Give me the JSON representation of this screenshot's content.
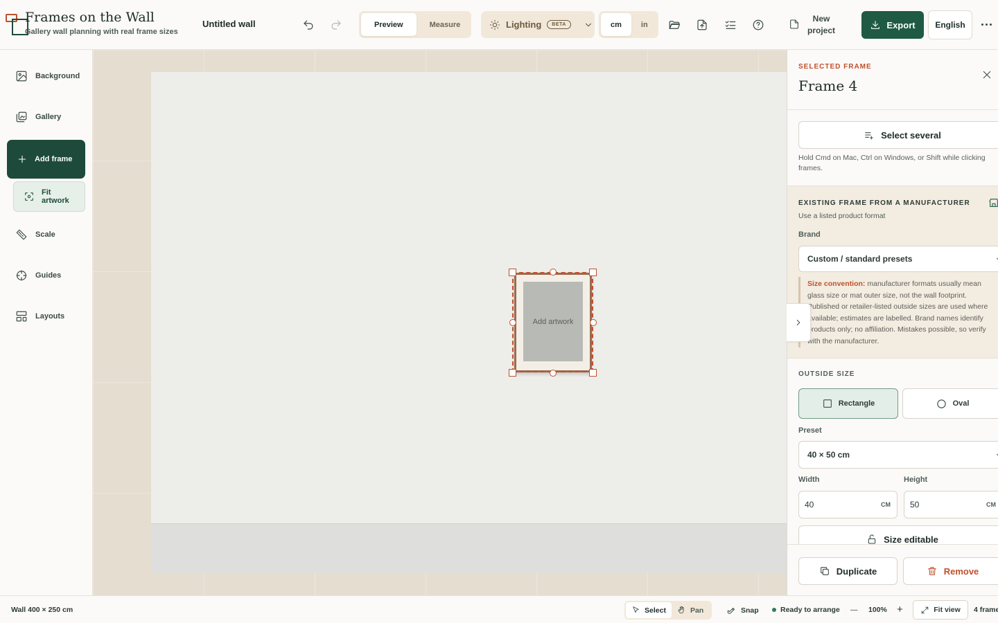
{
  "app": {
    "title": "Frames on the Wall",
    "subtitle": "Gallery wall planning with real frame sizes",
    "document_title": "Untitled wall"
  },
  "toolbar": {
    "undo_icon": "undo-icon",
    "redo_icon": "redo-icon",
    "view_modes": [
      {
        "label": "Preview",
        "active": true
      },
      {
        "label": "Measure",
        "active": false
      }
    ],
    "lighting_label": "Lighting",
    "lighting_badge": "BETA",
    "units": [
      {
        "label": "cm",
        "active": true
      },
      {
        "label": "in",
        "active": false
      }
    ],
    "new_project_label": "New project",
    "export_label": "Export",
    "language_label": "English"
  },
  "sidebar": {
    "items": [
      {
        "label": "Background",
        "icon": "image-icon"
      },
      {
        "label": "Gallery",
        "icon": "gallery-icon"
      },
      {
        "label": "Add frame",
        "icon": "plus-icon"
      },
      {
        "label": "Fit artwork",
        "icon": "fit-icon"
      },
      {
        "label": "Scale",
        "icon": "ruler-icon"
      },
      {
        "label": "Guides",
        "icon": "crosshair-icon"
      },
      {
        "label": "Layouts",
        "icon": "layout-icon"
      }
    ]
  },
  "canvas": {
    "frame_placeholder": "Add artwork"
  },
  "panel": {
    "eyebrow": "SELECTED FRAME",
    "title": "Frame 4",
    "select_several_label": "Select several",
    "select_hint": "Hold Cmd on Mac, Ctrl on Windows, or Shift while clicking frames.",
    "manufacturer": {
      "heading": "EXISTING FRAME FROM A MANUFACTURER",
      "subheading": "Use a listed product format",
      "brand_label": "Brand",
      "brand_value": "Custom / standard presets",
      "note_strong": "Size convention:",
      "note_text": " manufacturer formats usually mean glass size or mat outer size, not the wall footprint. Published or retailer-listed outside sizes are used where available; estimates are labelled. Brand names identify products only; no affiliation. Mistakes possible, so verify with the manufacturer."
    },
    "outside_size": {
      "heading": "OUTSIDE SIZE",
      "shapes": [
        {
          "label": "Rectangle",
          "active": true
        },
        {
          "label": "Oval",
          "active": false
        }
      ],
      "preset_label": "Preset",
      "preset_value": "40 × 50 cm",
      "width_label": "Width",
      "width_value": "40",
      "height_label": "Height",
      "height_value": "50",
      "unit": "CM",
      "size_editable_label": "Size editable"
    },
    "duplicate_label": "Duplicate",
    "remove_label": "Remove"
  },
  "status": {
    "wall_size": "Wall 400 × 250 cm",
    "select_label": "Select",
    "pan_label": "Pan",
    "snap_label": "Snap",
    "ready_label": "Ready to arrange",
    "zoom_minus": "—",
    "zoom_value": "100%",
    "zoom_plus": "+",
    "fit_view_label": "Fit view",
    "frame_count": "4 frame"
  },
  "colors": {
    "accent": "#c0502c",
    "brand_dark": "#1d4a3b",
    "export_green": "#1f5a44",
    "frame_wood": "#9c6a4e"
  }
}
